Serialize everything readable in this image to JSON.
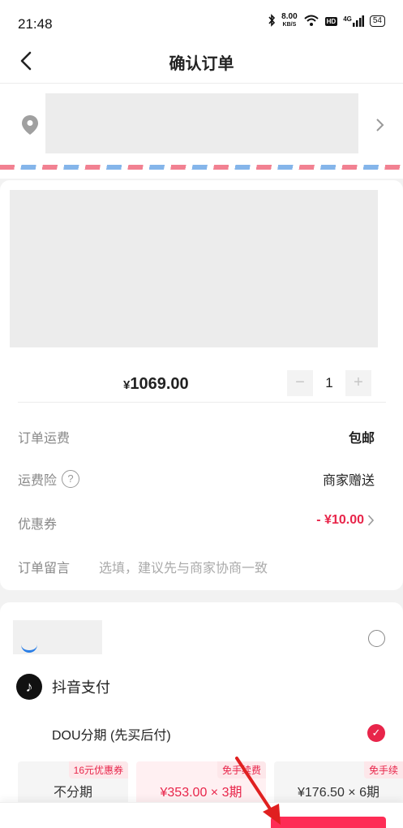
{
  "status_bar": {
    "time": "21:48",
    "speed_value": "8.00",
    "speed_unit": "KB/S",
    "hd_label": "HD",
    "network_label": "4G",
    "battery": "54"
  },
  "nav": {
    "title": "确认订单"
  },
  "product": {
    "currency": "¥",
    "price": "1069.00",
    "quantity": "1",
    "minus": "−",
    "plus": "+"
  },
  "order": {
    "shipping_label": "订单运费",
    "shipping_value": "包邮",
    "insurance_label": "运费险",
    "insurance_help": "?",
    "insurance_value": "商家赠送",
    "coupon_label": "优惠券",
    "coupon_value": "- ¥10.00",
    "message_label": "订单留言",
    "message_placeholder": "选填，建议先与商家协商一致"
  },
  "payment": {
    "douyin_logo": "♪",
    "douyin_label": "抖音支付",
    "dou_label": "DOU分期 (先买后付)",
    "check_mark": "✓",
    "plans": [
      {
        "tag": "16元优惠券",
        "text": "不分期"
      },
      {
        "tag": "免手续费",
        "text": "¥353.00 × 3期"
      },
      {
        "tag": "免手续",
        "text": "¥176.50 × 6期"
      }
    ]
  },
  "colors": {
    "accent": "#fe2c55",
    "price_red": "#e8254a",
    "annotation_arrow": "#e02020"
  }
}
